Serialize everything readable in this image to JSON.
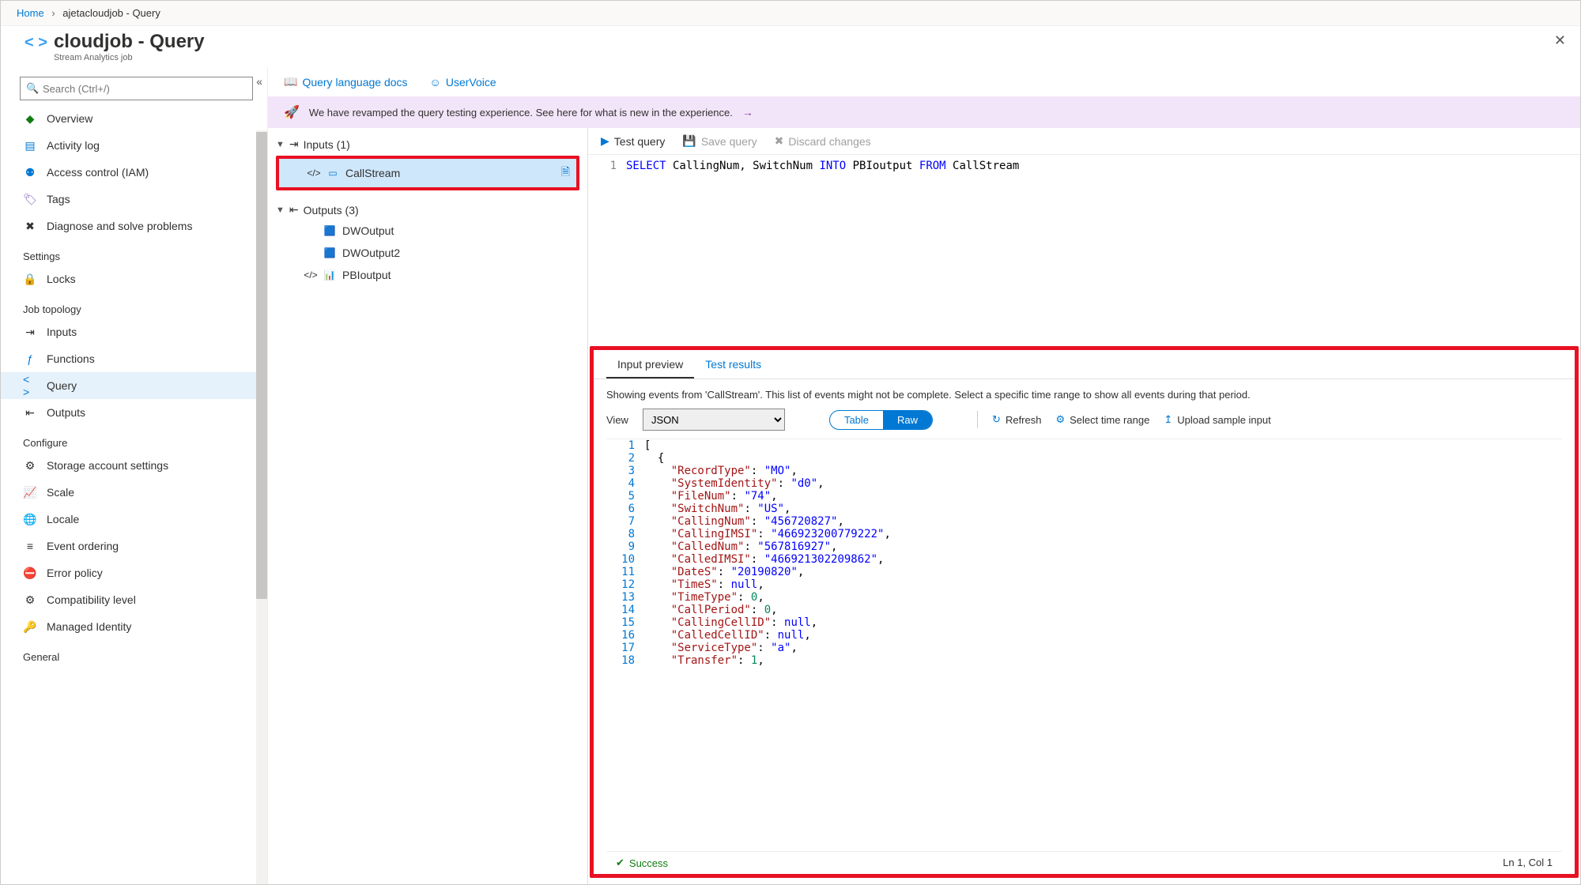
{
  "breadcrumb": {
    "home": "Home",
    "path": "ajetacloudjob - Query"
  },
  "header": {
    "title": "cloudjob - Query",
    "subtitle": "Stream Analytics job"
  },
  "search": {
    "placeholder": "Search (Ctrl+/)"
  },
  "nav": {
    "items_top": [
      {
        "label": "Overview",
        "icon": "◆",
        "cls": "icon-green"
      },
      {
        "label": "Activity log",
        "icon": "▤",
        "cls": "icon-blue"
      },
      {
        "label": "Access control (IAM)",
        "icon": "⚉",
        "cls": "icon-blue"
      },
      {
        "label": "Tags",
        "icon": "🏷",
        "cls": "icon-purple"
      },
      {
        "label": "Diagnose and solve problems",
        "icon": "✖",
        "cls": "icon-dark"
      }
    ],
    "section_settings": "Settings",
    "items_settings": [
      {
        "label": "Locks",
        "icon": "🔒",
        "cls": "icon-dark"
      }
    ],
    "section_topology": "Job topology",
    "items_topology": [
      {
        "label": "Inputs",
        "icon": "⇥",
        "cls": "icon-dark"
      },
      {
        "label": "Functions",
        "icon": "ƒ",
        "cls": "icon-blue"
      },
      {
        "label": "Query",
        "icon": "< >",
        "cls": "icon-blue",
        "active": true
      },
      {
        "label": "Outputs",
        "icon": "⇤",
        "cls": "icon-dark"
      }
    ],
    "section_configure": "Configure",
    "items_configure": [
      {
        "label": "Storage account settings",
        "icon": "⚙",
        "cls": "icon-dark"
      },
      {
        "label": "Scale",
        "icon": "📈",
        "cls": "icon-dark"
      },
      {
        "label": "Locale",
        "icon": "🌐",
        "cls": "icon-dark"
      },
      {
        "label": "Event ordering",
        "icon": "≡",
        "cls": "icon-dark"
      },
      {
        "label": "Error policy",
        "icon": "⛔",
        "cls": "icon-red"
      },
      {
        "label": "Compatibility level",
        "icon": "⚙",
        "cls": "icon-dark"
      },
      {
        "label": "Managed Identity",
        "icon": "🔑",
        "cls": "icon-yellow"
      }
    ],
    "section_general": "General"
  },
  "topbar": {
    "docs": "Query language docs",
    "uservoice": "UserVoice"
  },
  "banner": {
    "text": "We have revamped the query testing experience. See here for what is new in the experience."
  },
  "tree": {
    "inputs_label": "Inputs (1)",
    "inputs": [
      {
        "name": "CallStream"
      }
    ],
    "outputs_label": "Outputs (3)",
    "outputs": [
      {
        "name": "DWOutput",
        "icon": "sql"
      },
      {
        "name": "DWOutput2",
        "icon": "sql"
      },
      {
        "name": "PBIoutput",
        "icon": "pbi"
      }
    ]
  },
  "editor": {
    "toolbar": {
      "test": "Test query",
      "save": "Save query",
      "discard": "Discard changes"
    },
    "query_tokens": [
      {
        "t": "SELECT",
        "c": "kw"
      },
      {
        "t": " CallingNum, SwitchNum ",
        "c": "id"
      },
      {
        "t": "INTO",
        "c": "kw"
      },
      {
        "t": " PBIoutput ",
        "c": "id"
      },
      {
        "t": "FROM",
        "c": "kw"
      },
      {
        "t": " CallStream",
        "c": "id"
      }
    ]
  },
  "preview": {
    "tabs": {
      "input": "Input preview",
      "results": "Test results"
    },
    "info": "Showing events from 'CallStream'. This list of events might not be complete. Select a specific time range to show all events during that period.",
    "view_label": "View",
    "view_select": "JSON",
    "toggle": {
      "table": "Table",
      "raw": "Raw"
    },
    "actions": {
      "refresh": "Refresh",
      "timerange": "Select time range",
      "upload": "Upload sample input"
    },
    "json_lines": [
      [
        {
          "t": "[",
          "c": "jp"
        }
      ],
      [
        {
          "t": "  {",
          "c": "jp"
        }
      ],
      [
        {
          "t": "    ",
          "c": "jp"
        },
        {
          "t": "\"RecordType\"",
          "c": "jk"
        },
        {
          "t": ": ",
          "c": "jp"
        },
        {
          "t": "\"MO\"",
          "c": "js"
        },
        {
          "t": ",",
          "c": "jp"
        }
      ],
      [
        {
          "t": "    ",
          "c": "jp"
        },
        {
          "t": "\"SystemIdentity\"",
          "c": "jk"
        },
        {
          "t": ": ",
          "c": "jp"
        },
        {
          "t": "\"d0\"",
          "c": "js"
        },
        {
          "t": ",",
          "c": "jp"
        }
      ],
      [
        {
          "t": "    ",
          "c": "jp"
        },
        {
          "t": "\"FileNum\"",
          "c": "jk"
        },
        {
          "t": ": ",
          "c": "jp"
        },
        {
          "t": "\"74\"",
          "c": "js"
        },
        {
          "t": ",",
          "c": "jp"
        }
      ],
      [
        {
          "t": "    ",
          "c": "jp"
        },
        {
          "t": "\"SwitchNum\"",
          "c": "jk"
        },
        {
          "t": ": ",
          "c": "jp"
        },
        {
          "t": "\"US\"",
          "c": "js"
        },
        {
          "t": ",",
          "c": "jp"
        }
      ],
      [
        {
          "t": "    ",
          "c": "jp"
        },
        {
          "t": "\"CallingNum\"",
          "c": "jk"
        },
        {
          "t": ": ",
          "c": "jp"
        },
        {
          "t": "\"456720827\"",
          "c": "js"
        },
        {
          "t": ",",
          "c": "jp"
        }
      ],
      [
        {
          "t": "    ",
          "c": "jp"
        },
        {
          "t": "\"CallingIMSI\"",
          "c": "jk"
        },
        {
          "t": ": ",
          "c": "jp"
        },
        {
          "t": "\"466923200779222\"",
          "c": "js"
        },
        {
          "t": ",",
          "c": "jp"
        }
      ],
      [
        {
          "t": "    ",
          "c": "jp"
        },
        {
          "t": "\"CalledNum\"",
          "c": "jk"
        },
        {
          "t": ": ",
          "c": "jp"
        },
        {
          "t": "\"567816927\"",
          "c": "js"
        },
        {
          "t": ",",
          "c": "jp"
        }
      ],
      [
        {
          "t": "    ",
          "c": "jp"
        },
        {
          "t": "\"CalledIMSI\"",
          "c": "jk"
        },
        {
          "t": ": ",
          "c": "jp"
        },
        {
          "t": "\"466921302209862\"",
          "c": "js"
        },
        {
          "t": ",",
          "c": "jp"
        }
      ],
      [
        {
          "t": "    ",
          "c": "jp"
        },
        {
          "t": "\"DateS\"",
          "c": "jk"
        },
        {
          "t": ": ",
          "c": "jp"
        },
        {
          "t": "\"20190820\"",
          "c": "js"
        },
        {
          "t": ",",
          "c": "jp"
        }
      ],
      [
        {
          "t": "    ",
          "c": "jp"
        },
        {
          "t": "\"TimeS\"",
          "c": "jk"
        },
        {
          "t": ": ",
          "c": "jp"
        },
        {
          "t": "null",
          "c": "jnull"
        },
        {
          "t": ",",
          "c": "jp"
        }
      ],
      [
        {
          "t": "    ",
          "c": "jp"
        },
        {
          "t": "\"TimeType\"",
          "c": "jk"
        },
        {
          "t": ": ",
          "c": "jp"
        },
        {
          "t": "0",
          "c": "jn"
        },
        {
          "t": ",",
          "c": "jp"
        }
      ],
      [
        {
          "t": "    ",
          "c": "jp"
        },
        {
          "t": "\"CallPeriod\"",
          "c": "jk"
        },
        {
          "t": ": ",
          "c": "jp"
        },
        {
          "t": "0",
          "c": "jn"
        },
        {
          "t": ",",
          "c": "jp"
        }
      ],
      [
        {
          "t": "    ",
          "c": "jp"
        },
        {
          "t": "\"CallingCellID\"",
          "c": "jk"
        },
        {
          "t": ": ",
          "c": "jp"
        },
        {
          "t": "null",
          "c": "jnull"
        },
        {
          "t": ",",
          "c": "jp"
        }
      ],
      [
        {
          "t": "    ",
          "c": "jp"
        },
        {
          "t": "\"CalledCellID\"",
          "c": "jk"
        },
        {
          "t": ": ",
          "c": "jp"
        },
        {
          "t": "null",
          "c": "jnull"
        },
        {
          "t": ",",
          "c": "jp"
        }
      ],
      [
        {
          "t": "    ",
          "c": "jp"
        },
        {
          "t": "\"ServiceType\"",
          "c": "jk"
        },
        {
          "t": ": ",
          "c": "jp"
        },
        {
          "t": "\"a\"",
          "c": "js"
        },
        {
          "t": ",",
          "c": "jp"
        }
      ],
      [
        {
          "t": "    ",
          "c": "jp"
        },
        {
          "t": "\"Transfer\"",
          "c": "jk"
        },
        {
          "t": ": ",
          "c": "jp"
        },
        {
          "t": "1",
          "c": "jn"
        },
        {
          "t": ",",
          "c": "jp"
        }
      ]
    ],
    "status": {
      "success": "Success",
      "position": "Ln 1, Col 1"
    }
  }
}
